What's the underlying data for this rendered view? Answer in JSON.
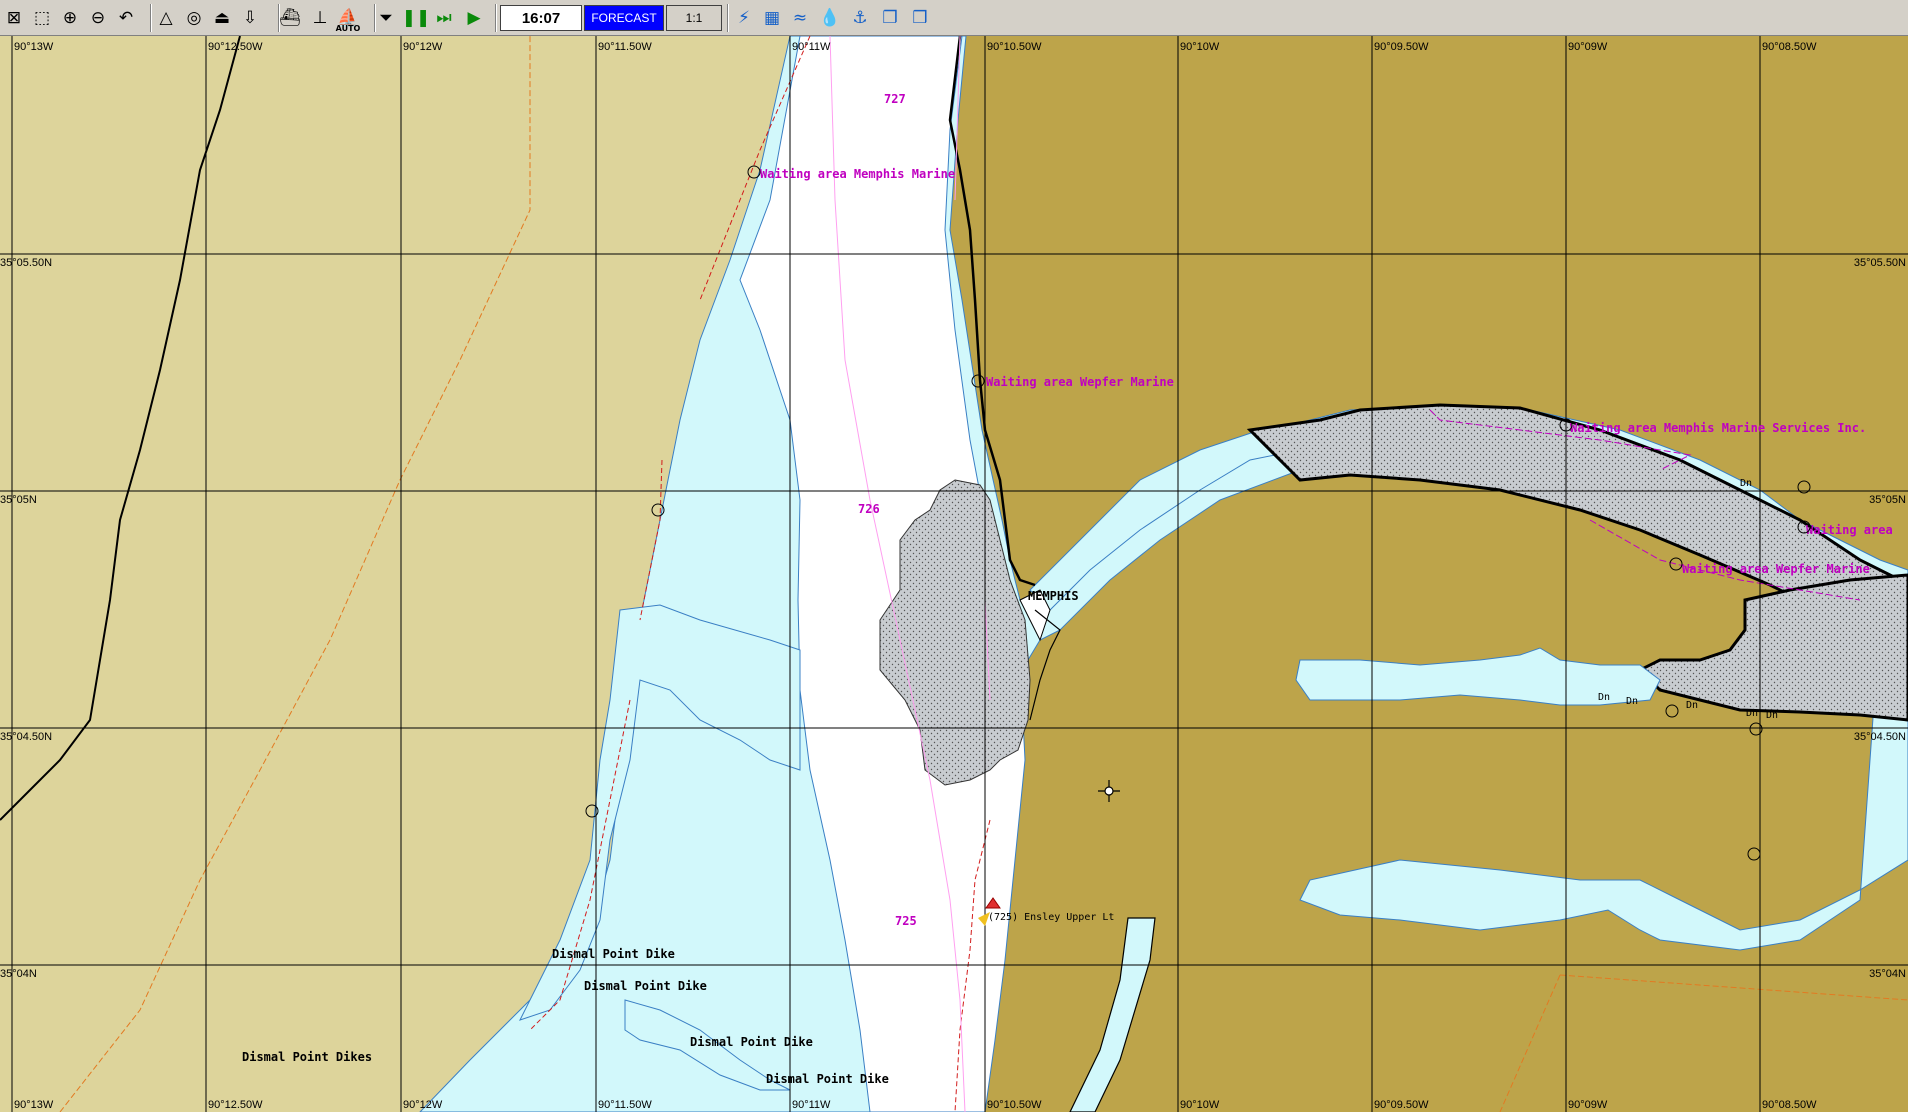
{
  "toolbar": {
    "buttons": [
      {
        "name": "close-chart-icon",
        "glyph": "⊠"
      },
      {
        "name": "select-area-icon",
        "glyph": "⬚"
      },
      {
        "name": "zoom-in-icon",
        "glyph": "⊕"
      },
      {
        "name": "zoom-out-icon",
        "glyph": "⊖"
      },
      {
        "name": "undo-view-icon",
        "glyph": "↶"
      },
      {
        "name": "measure-icon",
        "glyph": "△"
      },
      {
        "name": "target-icon",
        "glyph": "◎"
      },
      {
        "name": "export-icon",
        "glyph": "⏏"
      },
      {
        "name": "import-icon",
        "glyph": "⇩"
      },
      {
        "name": "vessel-icon",
        "glyph": "⛴"
      },
      {
        "name": "ship-track-icon",
        "glyph": "⊥"
      },
      {
        "name": "auto-mode-icon",
        "glyph": "⛵",
        "caption": "AUTO"
      },
      {
        "name": "eject-icon",
        "glyph": "⏷"
      },
      {
        "name": "pause-icon",
        "glyph": "❚❚"
      },
      {
        "name": "fast-forward-icon",
        "glyph": "⏭"
      },
      {
        "name": "play-icon",
        "glyph": "▶"
      },
      {
        "name": "layers-icon",
        "glyph": "⚡"
      },
      {
        "name": "chart-grid-icon",
        "glyph": "▦"
      },
      {
        "name": "currents-icon",
        "glyph": "≈"
      },
      {
        "name": "depth-icon",
        "glyph": "💧"
      },
      {
        "name": "tide-icon",
        "glyph": "⚓"
      },
      {
        "name": "copy-icon",
        "glyph": "❐"
      },
      {
        "name": "windows-icon",
        "glyph": "❒"
      }
    ],
    "time": "16:07",
    "forecast_label": "FORECAST",
    "scale": "1:1"
  },
  "grid": {
    "top_longitudes": [
      "90°13W",
      "90°12.50W",
      "90°12W",
      "90°11.50W",
      "90°11W",
      "90°10.50W",
      "90°10W",
      "90°09.50W",
      "90°09W",
      "90°08.50W"
    ],
    "bottom_longitudes": [
      "90°13W",
      "90°12.50W",
      "90°12W",
      "90°11.50W",
      "90°11W",
      "90°10.50W",
      "90°10W",
      "90°09.50W",
      "90°09W",
      "90°08.50W"
    ],
    "left_latitudes": [
      "35°05.50N",
      "35°05N",
      "35°04.50N",
      "35°04N"
    ],
    "right_latitudes": [
      "35°05.50N",
      "35°05N",
      "35°04.50N",
      "35°04N"
    ]
  },
  "map_labels": {
    "mile_727": "727",
    "mile_726": "726",
    "mile_725": "725",
    "waiting_memphis_marine": "Waiting area Memphis Marine",
    "waiting_wepfer_marine": "Waiting area Wepfer Marine",
    "waiting_memphis_services": "Waiting area Memphis Marine Services Inc.",
    "waiting_area_right": "Waiting area",
    "waiting_wepfer_right": "Waiting area Wepfer Marine",
    "memphis": "MEMPHIS",
    "ensley_light": "(725) Ensley Upper Lt",
    "dismal_dike_1": "Dismal Point Dike",
    "dismal_dike_2": "Dismal Point Dike",
    "dismal_dike_3": "Dismal Point Dike",
    "dismal_dike_4": "Dismal Point Dike",
    "dismal_dikes": "Dismal Point Dikes",
    "dn": "Dn"
  },
  "colors": {
    "land_light": "#ddd49b",
    "land_dark": "#bda44a",
    "shallow_water": "#d2f8fb",
    "deep_water": "#ffffff",
    "marsh": "#c4c8cc",
    "magenta": "#c000c0",
    "toolbar_bg": "#d4d0c8",
    "forecast_bg": "#0000ff"
  }
}
